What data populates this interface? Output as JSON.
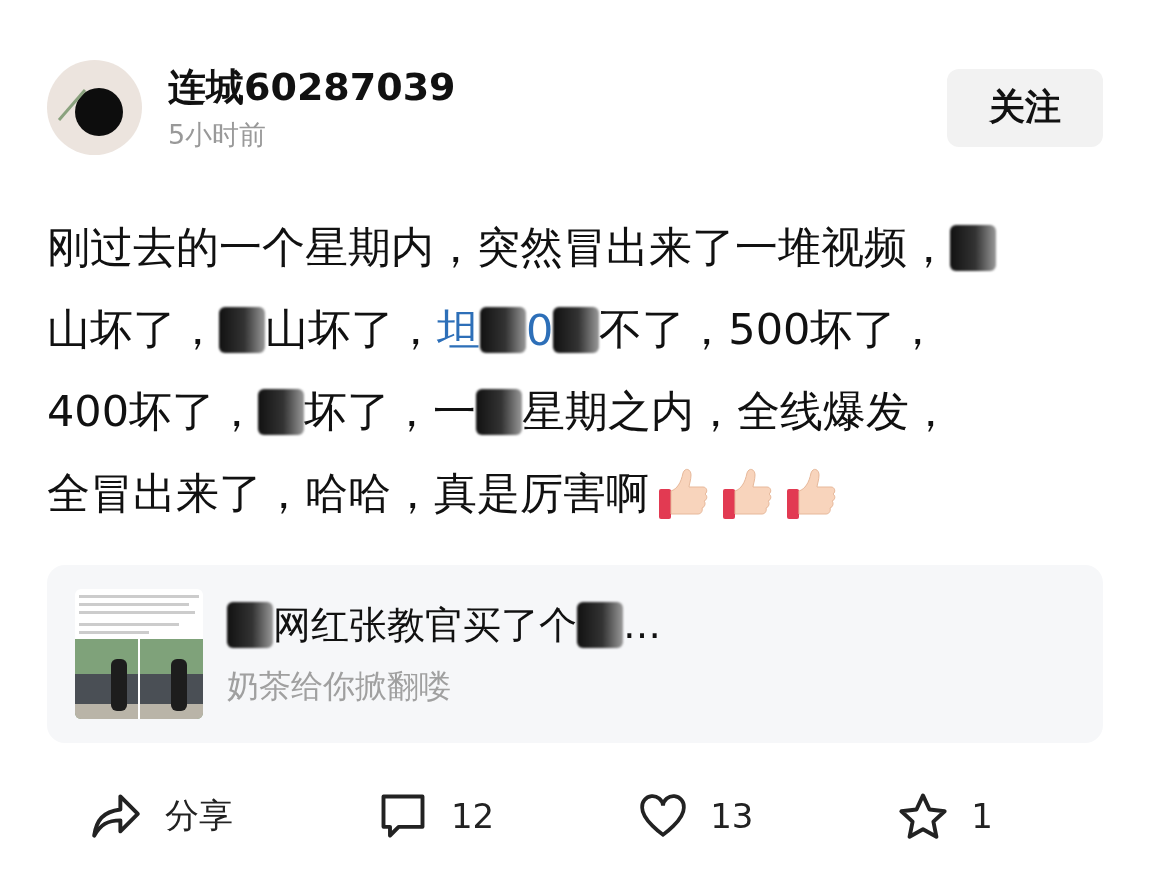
{
  "author": {
    "name": "连城60287039",
    "time": "5小时前"
  },
  "follow_button": "关注",
  "body": [
    [
      {
        "kind": "text",
        "text": "刚过去的一个星期内，突然冒出来了一堆视频，"
      },
      {
        "kind": "redaction"
      }
    ],
    [
      {
        "kind": "text",
        "text": "山坏了，"
      },
      {
        "kind": "redaction"
      },
      {
        "kind": "text",
        "text": "山坏了，"
      },
      {
        "kind": "link",
        "text": "坦"
      },
      {
        "kind": "redaction"
      },
      {
        "kind": "link",
        "text": "0"
      },
      {
        "kind": "redaction"
      },
      {
        "kind": "text",
        "text": "不了，500坏了，"
      }
    ],
    [
      {
        "kind": "text",
        "text": "400坏了，"
      },
      {
        "kind": "redaction"
      },
      {
        "kind": "text",
        "text": "坏了，一"
      },
      {
        "kind": "redaction"
      },
      {
        "kind": "text",
        "text": "星期之内，全线爆发，"
      }
    ],
    [
      {
        "kind": "text",
        "text": "全冒出来了，哈哈，真是厉害啊"
      },
      {
        "kind": "thumb"
      },
      {
        "kind": "thumb"
      },
      {
        "kind": "thumb"
      }
    ]
  ],
  "linked_post": {
    "title": [
      {
        "kind": "redaction"
      },
      {
        "kind": "text",
        "text": "网红张教官买了个"
      },
      {
        "kind": "redaction"
      },
      {
        "kind": "text",
        "text": "…"
      }
    ],
    "source": "奶茶给你掀翻喽"
  },
  "actions": [
    {
      "kind": "share",
      "label": "分享"
    },
    {
      "kind": "comment",
      "label": "12"
    },
    {
      "kind": "like",
      "label": "13"
    },
    {
      "kind": "star",
      "label": "1"
    }
  ]
}
